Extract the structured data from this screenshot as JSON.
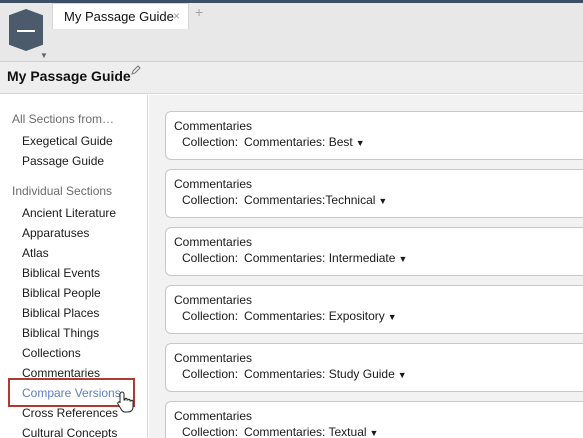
{
  "tabs": {
    "active_label": "My Passage Guide",
    "close_symbol": "×",
    "add_symbol": "+"
  },
  "page": {
    "title": "My Passage Guide"
  },
  "sidebar": {
    "heading_all": "All Sections from…",
    "guides": [
      "Exegetical Guide",
      "Passage Guide"
    ],
    "heading_individual": "Individual Sections",
    "items": [
      "Ancient Literature",
      "Apparatuses",
      "Atlas",
      "Biblical Events",
      "Biblical People",
      "Biblical Places",
      "Biblical Things",
      "Collections",
      "Commentaries",
      "Compare Versions",
      "Cross References",
      "Cultural Concepts"
    ],
    "hovered_item": "Compare Versions"
  },
  "cards": [
    {
      "title": "Commentaries",
      "collection_label": "Collection:",
      "collection_value": "Commentaries: Best"
    },
    {
      "title": "Commentaries",
      "collection_label": "Collection:",
      "collection_value": "Commentaries:Technical"
    },
    {
      "title": "Commentaries",
      "collection_label": "Collection:",
      "collection_value": "Commentaries: Intermediate"
    },
    {
      "title": "Commentaries",
      "collection_label": "Collection:",
      "collection_value": "Commentaries: Expository"
    },
    {
      "title": "Commentaries",
      "collection_label": "Collection:",
      "collection_value": "Commentaries: Study Guide"
    },
    {
      "title": "Commentaries",
      "collection_label": "Collection:",
      "collection_value": "Commentaries: Textual"
    }
  ],
  "icons": {
    "app": "logos-app-icon",
    "edit": "pencil-icon",
    "dropdown": "caret-down-icon",
    "cursor": "hand-pointer-icon"
  },
  "colors": {
    "accent_topline": "#3d4f63",
    "hover_link": "#5e7fbf",
    "highlight_box": "#b03a2e"
  }
}
